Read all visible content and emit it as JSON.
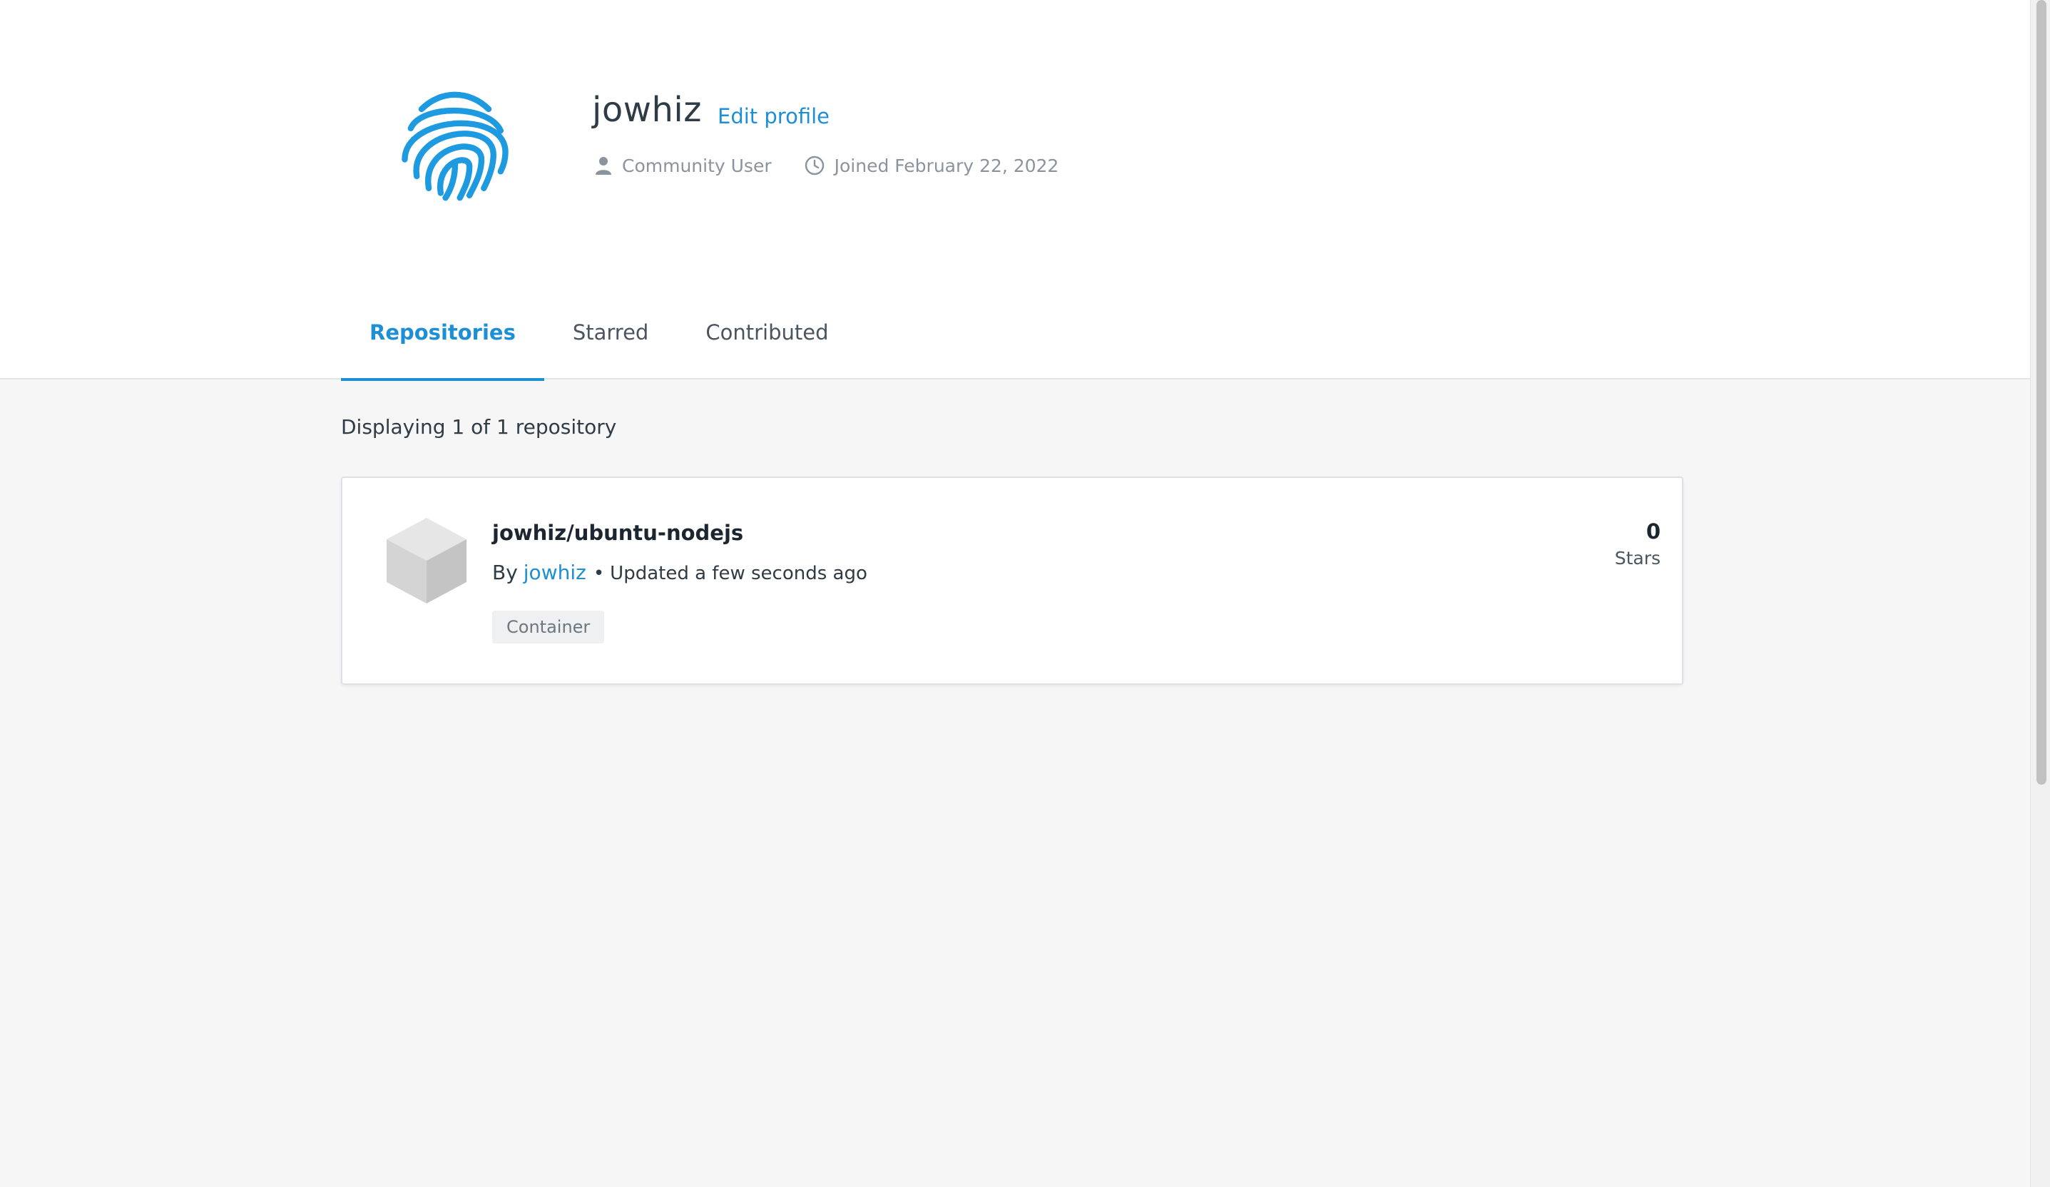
{
  "profile": {
    "username": "jowhiz",
    "edit_profile_label": "Edit profile",
    "role": "Community User",
    "joined": "Joined February 22, 2022",
    "avatar_icon": "fingerprint-icon",
    "accent_color": "#1d8fd5"
  },
  "tabs": [
    {
      "label": "Repositories",
      "active": true
    },
    {
      "label": "Starred",
      "active": false
    },
    {
      "label": "Contributed",
      "active": false
    }
  ],
  "results": {
    "summary": "Displaying 1 of 1 repository"
  },
  "repositories": [
    {
      "name": "jowhiz/ubuntu-nodejs",
      "by_label": "By",
      "author": "jowhiz",
      "separator": "•",
      "updated": "Updated a few seconds ago",
      "badge": "Container",
      "stars_count": "0",
      "stars_label": "Stars",
      "icon": "cube-icon"
    }
  ]
}
